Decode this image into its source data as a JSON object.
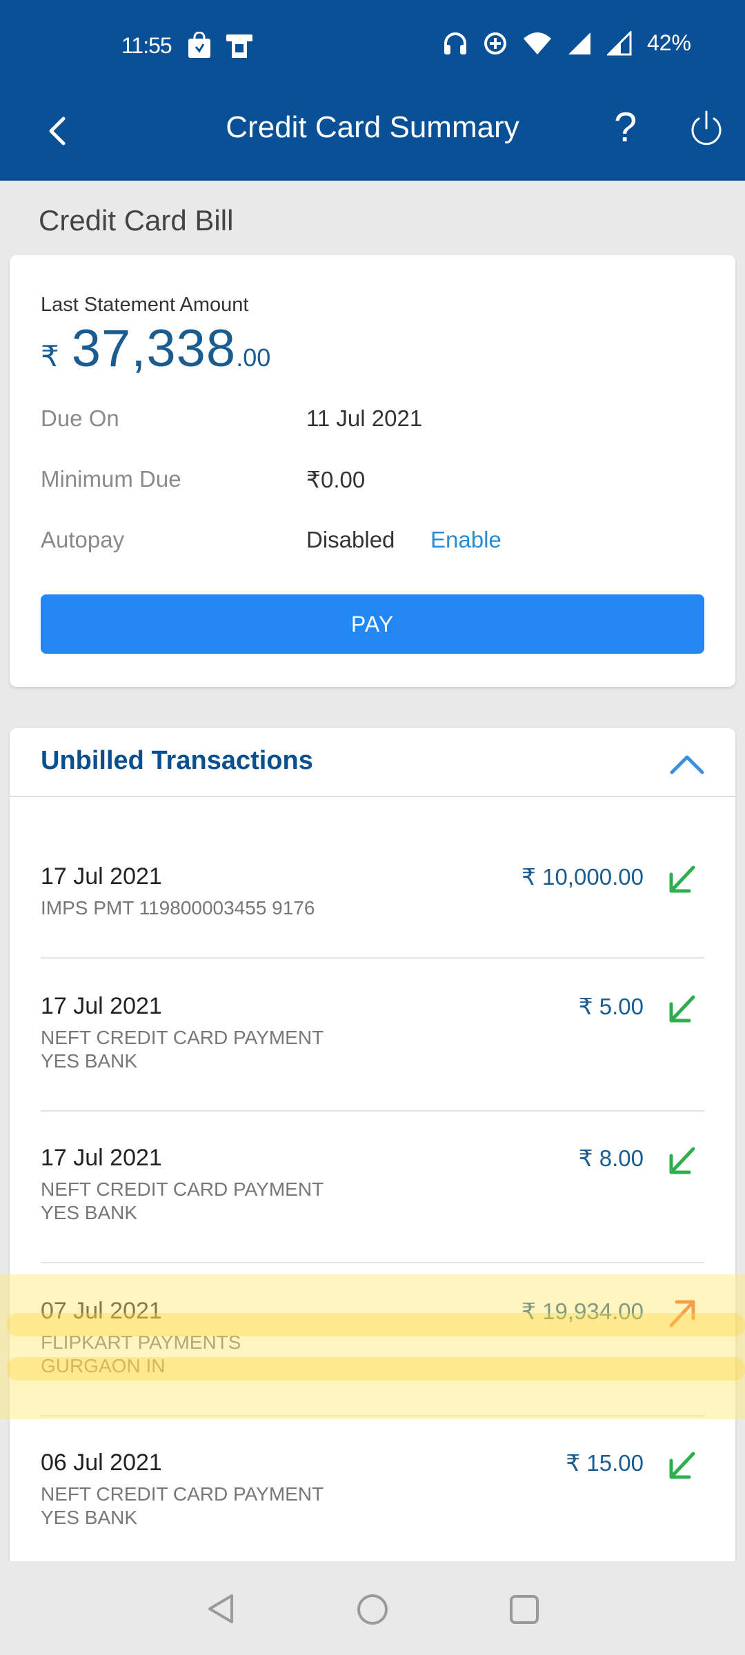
{
  "status_bar": {
    "time": "11:55",
    "battery": "42%",
    "icons": [
      "shopping-bag-icon",
      "atm-icon",
      "headphones-icon",
      "data-saver-icon",
      "wifi-icon",
      "signal-icon",
      "signal-icon"
    ]
  },
  "app_bar": {
    "title": "Credit Card Summary",
    "help_label": "?",
    "icons": [
      "back-arrow-icon",
      "help-icon",
      "power-icon"
    ]
  },
  "bill_section": {
    "title": "Credit Card Bill",
    "last_statement_label": "Last Statement Amount",
    "currency_symbol": "₹",
    "amount_main": "37,338",
    "amount_decimal": ".00",
    "due_on_label": "Due On",
    "due_on_value": "11 Jul 2021",
    "minimum_due_label": "Minimum Due",
    "minimum_due_value": "₹0.00",
    "autopay_label": "Autopay",
    "autopay_value": "Disabled",
    "enable_label": "Enable",
    "pay_button": "PAY"
  },
  "unbilled": {
    "title": "Unbilled Transactions",
    "transactions": [
      {
        "date": "17 Jul 2021",
        "desc_line1": "IMPS PMT 119800003455 9176",
        "desc_line2": "",
        "amount": "₹ 10,000.00",
        "direction": "credit"
      },
      {
        "date": "17 Jul 2021",
        "desc_line1": "NEFT CREDIT CARD PAYMENT",
        "desc_line2": "YES BANK",
        "amount": "₹ 5.00",
        "direction": "credit"
      },
      {
        "date": "17 Jul 2021",
        "desc_line1": "NEFT CREDIT CARD PAYMENT",
        "desc_line2": "YES BANK",
        "amount": "₹ 8.00",
        "direction": "credit"
      },
      {
        "date": "07 Jul 2021",
        "desc_line1": "FLIPKART PAYMENTS",
        "desc_line2": "GURGAON IN",
        "amount": "₹ 19,934.00",
        "direction": "debit"
      },
      {
        "date": "06 Jul 2021",
        "desc_line1": "NEFT CREDIT CARD PAYMENT",
        "desc_line2": "YES BANK",
        "amount": "₹ 15.00",
        "direction": "credit"
      }
    ]
  },
  "colors": {
    "header_blue": "#0a5096",
    "pay_button_blue": "#2287f2",
    "credit_green": "#2fae4e",
    "debit_orange": "#ea6a2a",
    "highlight_yellow": "#ffe46e"
  }
}
